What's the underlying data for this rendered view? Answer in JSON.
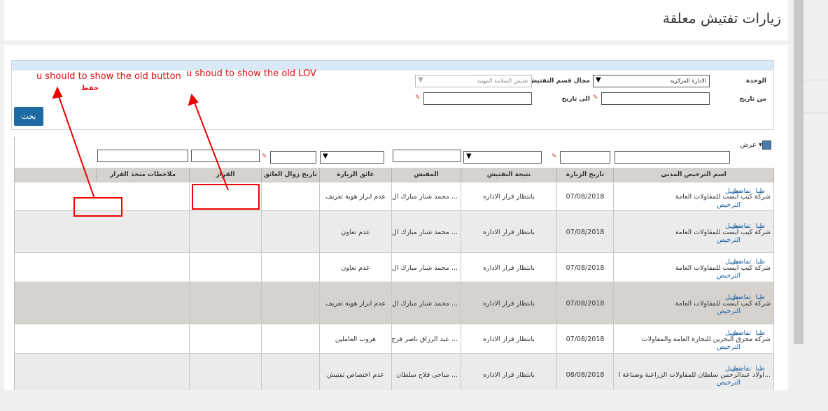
{
  "page": {
    "title": "زيارات تفتيش معلقة"
  },
  "filters": {
    "unit_label": "الوحدة",
    "unit_value": "الادارة المركزية",
    "section_label": "مجال قسم التفتيش",
    "section_value": "تفتيش السلامة المهنية",
    "from_date_label": "من تاريخ",
    "to_date_label": "الى تاريخ",
    "search_button": "بحث"
  },
  "table": {
    "view_menu": "عرض",
    "columns": [
      "اسم الترخيص المدني",
      "تاريخ الزيارة",
      "نتيجة التفتيش",
      "المفتش",
      "عائق الزيارة",
      "تاريخ زوال العائق",
      "القرار",
      "ملاحظات متخذ القرار"
    ],
    "actions": {
      "edit": "تعديل",
      "details": "تفاصيل",
      "print": "طبا",
      "license": "الترخيص"
    },
    "rows": [
      {
        "name": "شركة كيب ايست للمقاولات العامة",
        "date": "07/08/2018",
        "result": "بانتظار قرار الاداره",
        "inspector": "محمد شنار مبارك ال ...",
        "obstacle": "عدم ابراز هوية تعريف"
      },
      {
        "name": "شركة كيب ايست للمقاولات العامة",
        "date": "07/08/2018",
        "result": "بانتظار قرار الاداره",
        "inspector": "محمد شنار مبارك ال ...",
        "obstacle": "عدم تعاون"
      },
      {
        "name": "شركة كيب ايست للمقاولات العامة",
        "date": "07/08/2018",
        "result": "بانتظار قرار الاداره",
        "inspector": "محمد شنار مبارك ال ...",
        "obstacle": "عدم تعاون"
      },
      {
        "name": "شركة كيب ايست للمقاولات العامة",
        "date": "07/08/2018",
        "result": "بانتظار قرار الاداره",
        "inspector": "محمد شنار مبارك ال ...",
        "obstacle": "عدم ابراز هوية تعريف"
      },
      {
        "name": "شركة محرق البحرين للتجارة العامة والمقاولات",
        "date": "07/08/2018",
        "result": "بانتظار قرار الاداره",
        "inspector": "عبد الرزاق ناصر فرج ...",
        "obstacle": "هروب العاملين"
      },
      {
        "name": "اولاد عبدالرحمن سلطان للمقاولات الزراعية وصناعة ا...",
        "date": "08/08/2018",
        "result": "بانتظار قرار الاداره",
        "inspector": "مناحى فلاح سلطان ...",
        "obstacle": "عدم اختصاص تفتيش"
      }
    ]
  },
  "annotations": {
    "note_button": "u should to show the old button",
    "note_button_sub": "حفظ",
    "note_lov": "u shoud to show the old LOV"
  },
  "colors": {
    "accent": "#1e6aa5",
    "annotation": "#dd1111",
    "header_bg": "#d6d3ce",
    "filter_head": "#d9e9f7"
  }
}
